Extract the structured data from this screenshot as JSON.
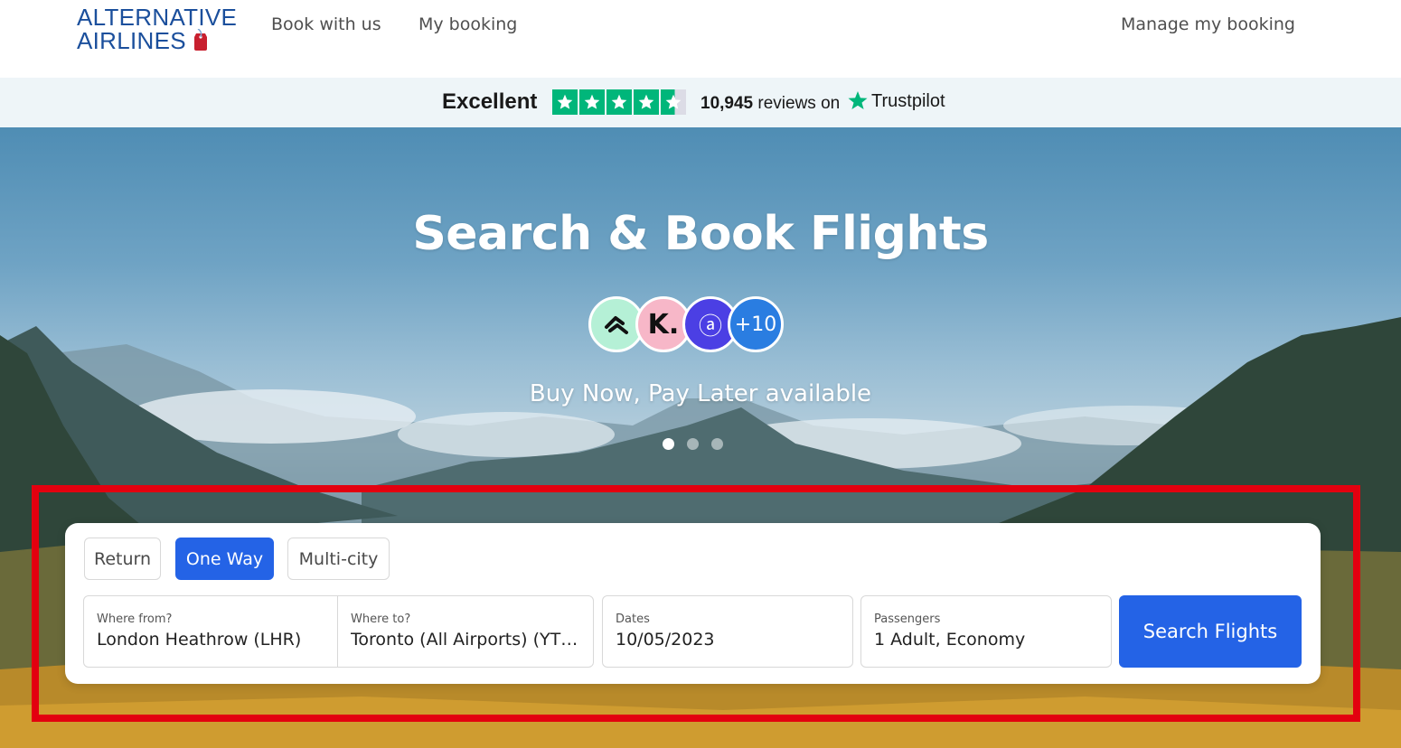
{
  "brand": {
    "line1": "ALTERNATIVE",
    "line2": "AIRLINES",
    "logo_icon": "luggage-tag-icon",
    "accent_color": "#1b4f9c",
    "tag_color": "#c8202f"
  },
  "nav": {
    "book_with_us": "Book with us",
    "my_booking": "My booking",
    "manage_my_booking": "Manage my booking"
  },
  "trustpilot": {
    "rating_word": "Excellent",
    "stars": 4.5,
    "review_count": "10,945",
    "reviews_suffix": "reviews on",
    "brand": "Trustpilot",
    "star_color": "#00b67a"
  },
  "hero": {
    "title": "Search & Book Flights",
    "bnpl_providers": [
      {
        "icon": "clearpay-icon",
        "color": "#b5f0d6"
      },
      {
        "label": "K.",
        "icon": "klarna-icon",
        "color": "#f7b7c8"
      },
      {
        "label": "ⓐ",
        "icon": "affirm-icon",
        "color": "#4b3fe4"
      },
      {
        "label": "+10",
        "color": "#2a7de1"
      }
    ],
    "subtitle": "Buy Now, Pay Later available",
    "slides_total": 3,
    "active_slide": 1
  },
  "search": {
    "trip_types": {
      "return": "Return",
      "one_way": "One Way",
      "multi_city": "Multi-city"
    },
    "selected_trip_type": "One Way",
    "from": {
      "label": "Where from?",
      "value": "London Heathrow (LHR)"
    },
    "to": {
      "label": "Where to?",
      "value": "Toronto (All Airports) (YTO)"
    },
    "dates": {
      "label": "Dates",
      "value": "10/05/2023"
    },
    "passengers": {
      "label": "Passengers",
      "value": "1 Adult, Economy"
    },
    "submit": "Search Flights",
    "primary_color": "#2463e6"
  },
  "highlight_color": "#e3000f"
}
